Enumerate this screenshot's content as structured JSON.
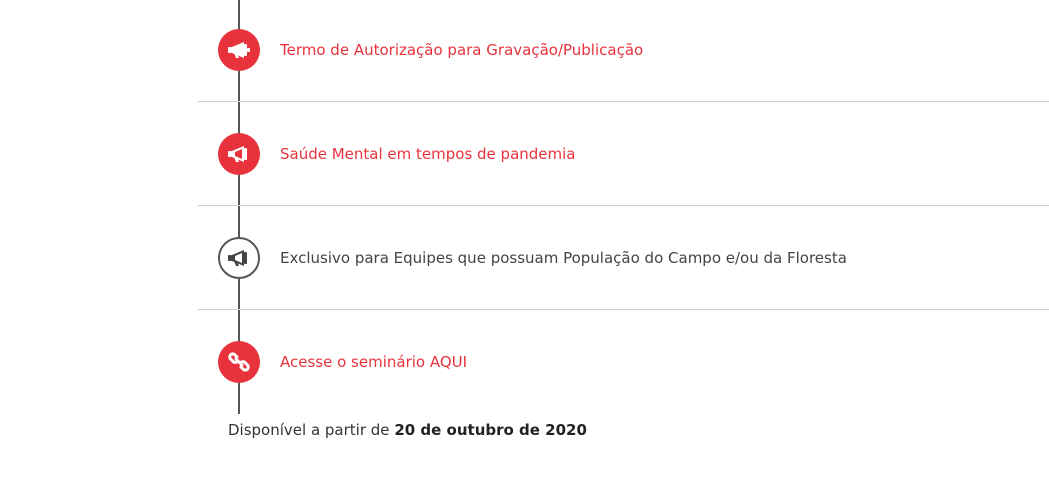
{
  "timeline": {
    "items": [
      {
        "label": "Termo de Autorização para Gravação/Publicação",
        "icon": "megaphone-icon",
        "style": "highlighted"
      },
      {
        "label": "Saúde Mental em tempos de pandemia",
        "icon": "megaphone-icon",
        "style": "highlighted"
      },
      {
        "label": "Exclusivo para Equipes que possuam População do Campo e/ou da Floresta",
        "icon": "megaphone-icon",
        "style": "outline"
      },
      {
        "label": "Acesse o seminário AQUI",
        "icon": "link-icon",
        "style": "highlighted"
      }
    ],
    "availability": {
      "prefix": "Disponível a partir de",
      "date": "20 de outubro de 2020"
    }
  },
  "colors": {
    "accent": "#e8333c",
    "line": "#555555",
    "divider": "#cfcfcf",
    "text_dark": "#444444"
  }
}
